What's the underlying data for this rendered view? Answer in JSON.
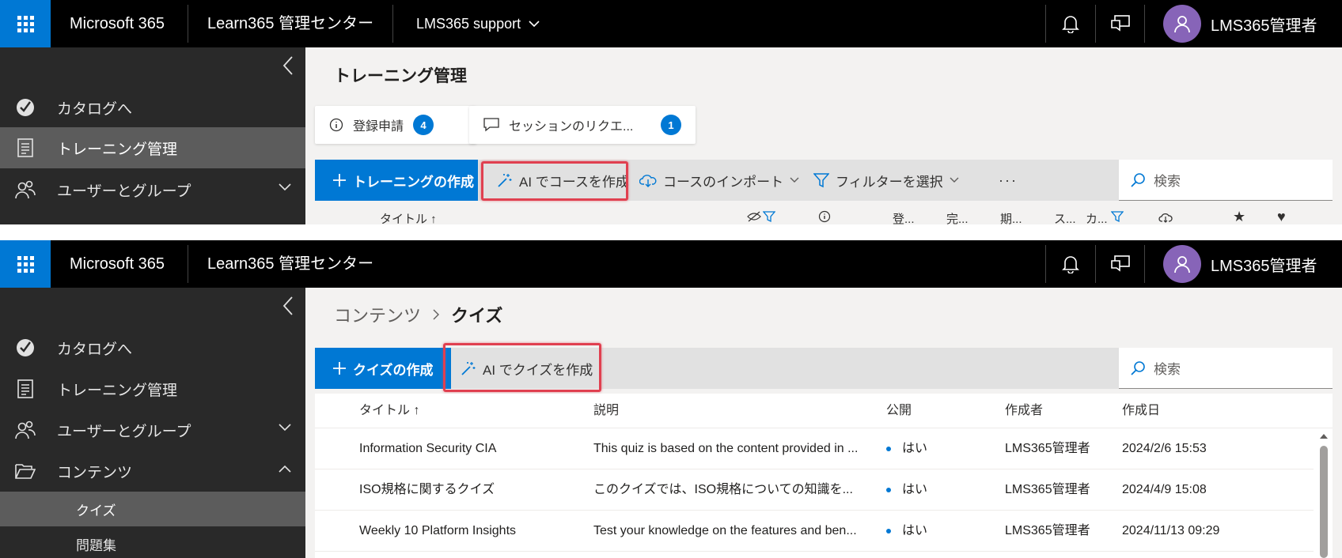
{
  "topbar": {
    "brand": "Microsoft 365",
    "app_name": "Learn365 管理センター",
    "tenant": "LMS365 support",
    "user_name": "LMS365管理者"
  },
  "sidebar": {
    "items": [
      {
        "label": "カタログへ"
      },
      {
        "label": "トレーニング管理"
      },
      {
        "label": "ユーザーとグループ"
      },
      {
        "label": "コンテンツ"
      }
    ],
    "sub_items": [
      {
        "label": "クイズ"
      },
      {
        "label": "問題集"
      }
    ]
  },
  "screen1": {
    "page_title": "トレーニング管理",
    "cards": [
      {
        "label": "登録申請",
        "count": "4"
      },
      {
        "label": "セッションのリクエ...",
        "count": "1"
      }
    ],
    "commands": {
      "create": "トレーニングの作成",
      "ai_create": "AI でコースを作成",
      "import": "コースのインポート",
      "filter": "フィルターを選択",
      "more": "···"
    },
    "search_placeholder": "検索",
    "columns": {
      "title": "タイトル",
      "c1": "登...",
      "c2": "完...",
      "c3": "期...",
      "c4": "ス...",
      "c5": "カ..."
    }
  },
  "screen2": {
    "breadcrumb": {
      "parent": "コンテンツ",
      "current": "クイズ"
    },
    "commands": {
      "create": "クイズの作成",
      "ai_create": "AI でクイズを作成"
    },
    "search_placeholder": "検索",
    "columns": {
      "title": "タイトル",
      "description": "説明",
      "published": "公開",
      "author": "作成者",
      "created": "作成日"
    },
    "rows": [
      {
        "title": "Information Security CIA",
        "description": "This quiz is based on the content provided in ...",
        "published": "はい",
        "author": "LMS365管理者",
        "created": "2024/2/6 15:53"
      },
      {
        "title": "ISO規格に関するクイズ",
        "description": "このクイズでは、ISO規格についての知識を...",
        "published": "はい",
        "author": "LMS365管理者",
        "created": "2024/4/9 15:08"
      },
      {
        "title": "Weekly 10 Platform Insights",
        "description": "Test your knowledge on the features and ben...",
        "published": "はい",
        "author": "LMS365管理者",
        "created": "2024/11/13 09:29"
      }
    ]
  },
  "colors": {
    "accent": "#0078d4",
    "highlight": "#e04050",
    "sidebar_bg": "#292929",
    "topbar_bg": "#000000",
    "avatar": "#8764b8"
  }
}
